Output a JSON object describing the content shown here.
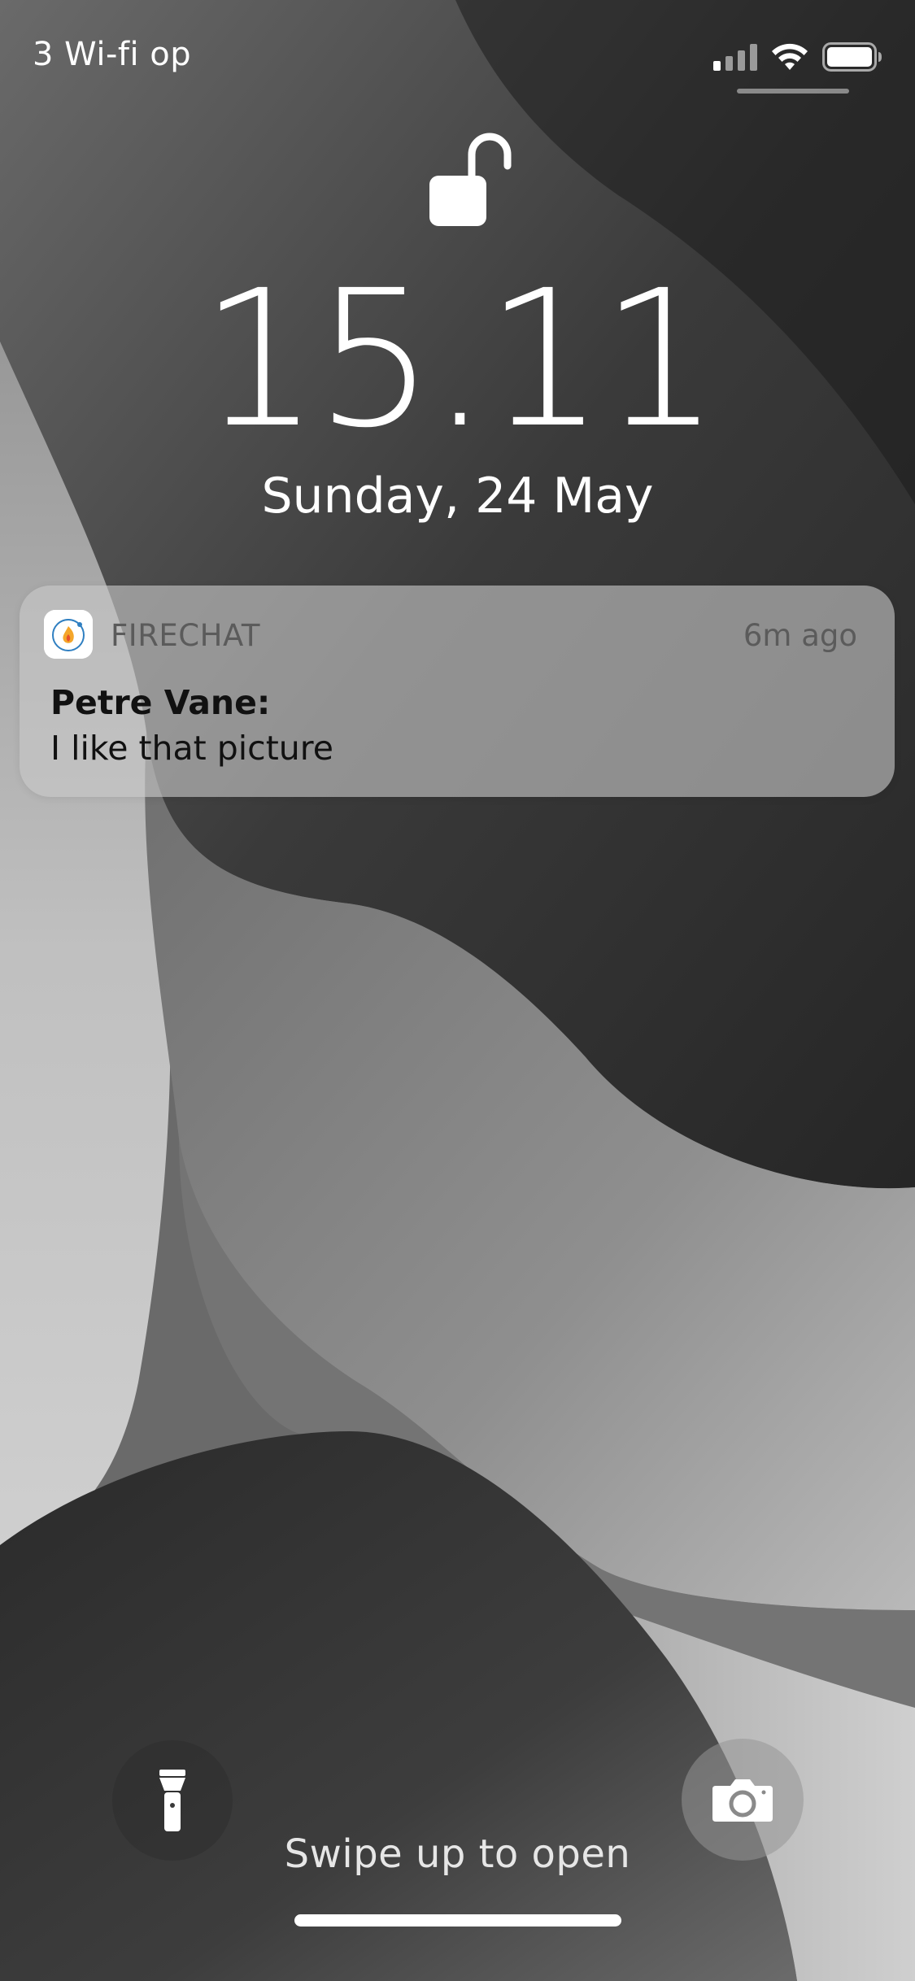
{
  "status_bar": {
    "carrier": "3 Wi-fi op",
    "cellular_icon": "cellular-signal-icon",
    "wifi_icon": "wifi-icon",
    "battery_icon": "battery-icon"
  },
  "lock_screen": {
    "lock_icon": "unlocked-padlock-icon",
    "time": "15.11",
    "date": "Sunday, 24 May"
  },
  "notification": {
    "app_icon": "firechat-app-icon",
    "app_name": "FIRECHAT",
    "time_ago": "6m ago",
    "sender": "Petre Vane:",
    "message": "I like that picture"
  },
  "bottom_controls": {
    "flashlight_icon": "flashlight-icon",
    "camera_icon": "camera-icon",
    "swipe_hint": "Swipe up to open"
  },
  "colors": {
    "text_primary": "#ffffff",
    "notification_text": "#111111",
    "notification_secondary": "#5b5b5b"
  }
}
